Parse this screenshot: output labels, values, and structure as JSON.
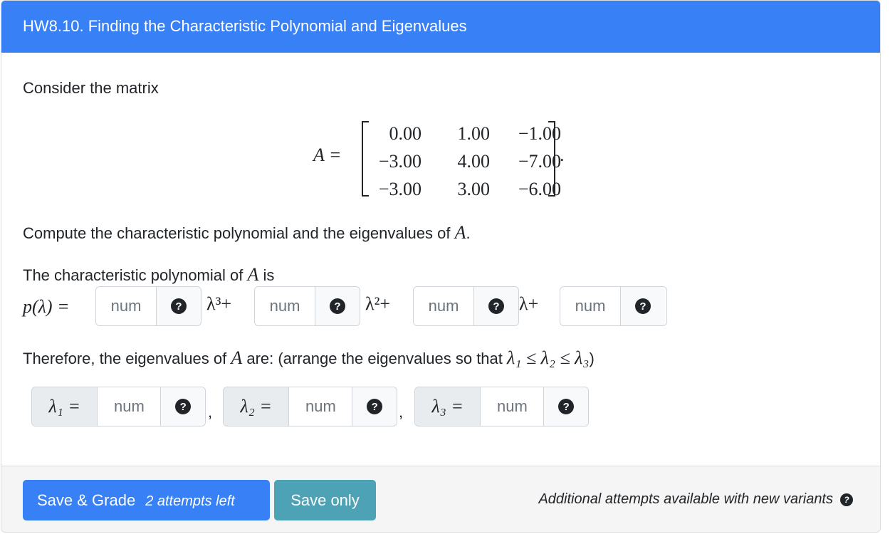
{
  "header": {
    "title": "HW8.10. Finding the Characteristic Polynomial and Eigenvalues"
  },
  "question": {
    "intro": "Consider the matrix",
    "matrix_label": "A =",
    "matrix": [
      [
        "0.00",
        "1.00",
        "−1.00"
      ],
      [
        "−3.00",
        "4.00",
        "−7.00"
      ],
      [
        "−3.00",
        "3.00",
        "−6.00"
      ]
    ],
    "matrix_end": ".",
    "compute_text": "Compute the characteristic polynomial and the eigenvalues of",
    "compute_var": "A",
    "compute_end": ".",
    "poly_intro": "The characteristic polynomial of",
    "poly_var": "A",
    "poly_intro_end": "is",
    "poly_lhs": "p(λ) =",
    "poly_terms": [
      "λ³+",
      "λ²+",
      "λ+"
    ],
    "eig_intro": "Therefore, the eigenvalues of",
    "eig_var": "A",
    "eig_intro_end": "are: (arrange the eigenvalues so that",
    "eig_order": "λ₁ ≤ λ₂ ≤ λ₃",
    "eig_close": ")",
    "eig_labels": [
      "λ₁ =",
      "λ₂ =",
      "λ₃ ="
    ],
    "separator": ","
  },
  "inputs": {
    "placeholder": "num",
    "coef_values": [
      "",
      "",
      "",
      ""
    ],
    "eig_values": [
      "",
      "",
      ""
    ],
    "help_icon": "question-circle-icon"
  },
  "footer": {
    "grade_label": "Save & Grade",
    "attempts_left": "2 attempts left",
    "save_label": "Save only",
    "note": "Additional attempts available with new variants"
  }
}
